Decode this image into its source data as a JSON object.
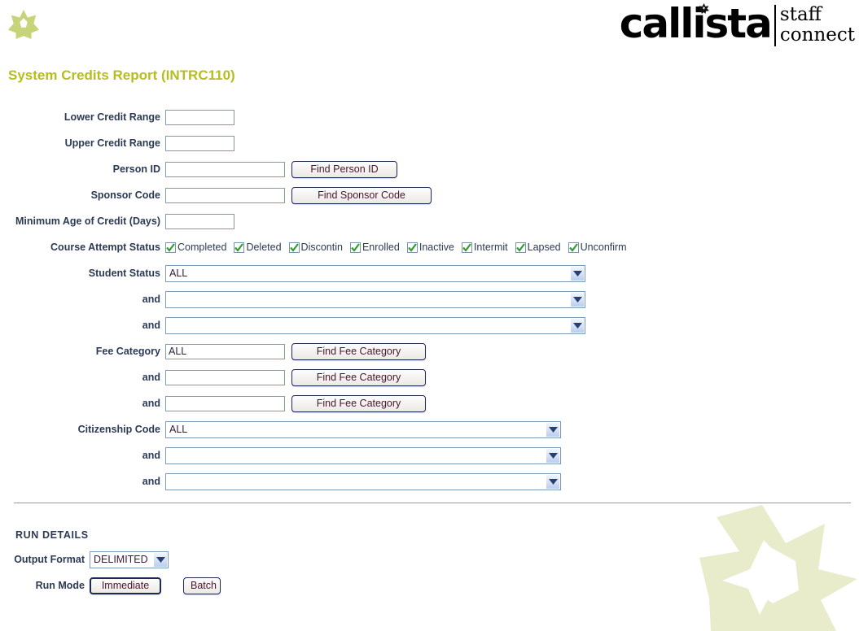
{
  "brand": {
    "name": "callista",
    "sub_line1": "staff",
    "sub_line2": "connect",
    "logo_icon": "star-icon",
    "i_dot_icon": "star-icon",
    "watermark_icon": "star-watermark-icon"
  },
  "page": {
    "title": "System Credits Report (INTRC110)",
    "title_color": "#b5bd1f"
  },
  "form": {
    "lower_credit_range": {
      "label": "Lower Credit Range",
      "value": ""
    },
    "upper_credit_range": {
      "label": "Upper Credit Range",
      "value": ""
    },
    "person_id": {
      "label": "Person ID",
      "value": "",
      "button": "Find Person ID"
    },
    "sponsor_code": {
      "label": "Sponsor Code",
      "value": "",
      "button": "Find Sponsor Code"
    },
    "minimum_age": {
      "label": "Minimum Age of Credit (Days)",
      "value": ""
    },
    "course_attempt_status": {
      "label": "Course Attempt Status",
      "items": [
        {
          "label": "Completed",
          "checked": true
        },
        {
          "label": "Deleted",
          "checked": true
        },
        {
          "label": "Discontin",
          "checked": true
        },
        {
          "label": "Enrolled",
          "checked": true
        },
        {
          "label": "Inactive",
          "checked": true
        },
        {
          "label": "Intermit",
          "checked": true
        },
        {
          "label": "Lapsed",
          "checked": true
        },
        {
          "label": "Unconfirm",
          "checked": true
        }
      ]
    },
    "student_status": {
      "label": "Student Status",
      "and_label": "and",
      "values": [
        "ALL",
        "",
        ""
      ]
    },
    "fee_category": {
      "label": "Fee Category",
      "and_label": "and",
      "button": "Find Fee Category",
      "values": [
        "ALL",
        "",
        ""
      ]
    },
    "citizenship_code": {
      "label": "Citizenship Code",
      "and_label": "and",
      "values": [
        "ALL",
        "",
        ""
      ]
    }
  },
  "run_details": {
    "title": "RUN DETAILS",
    "output_format": {
      "label": "Output Format",
      "value": "DELIMITED"
    },
    "run_mode": {
      "label": "Run Mode",
      "immediate": "Immediate",
      "batch": "Batch"
    }
  },
  "colors": {
    "accent_green": "#b5bd1f",
    "watermark_green": "#e8ecca",
    "label_navy": "#2b3a55",
    "button_text": "#4a1533",
    "input_border": "#7b9ab5",
    "check_green": "#2f9e2f"
  }
}
